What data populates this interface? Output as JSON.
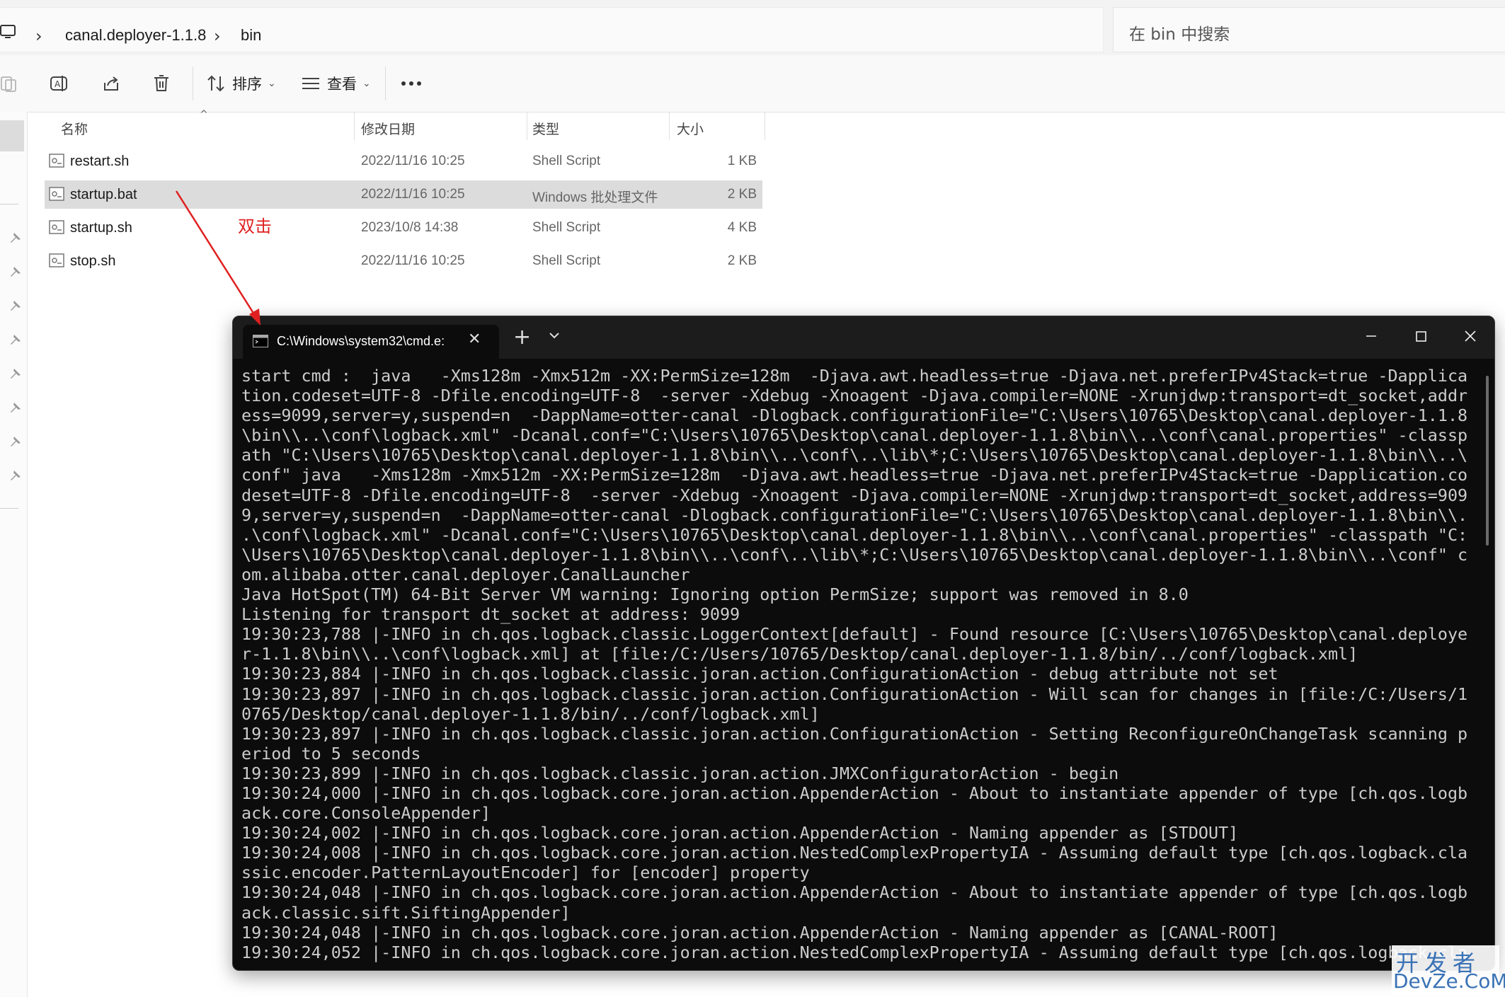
{
  "address_bar": {
    "crumbs": [
      "canal.deployer-1.1.8",
      "bin"
    ],
    "search_placeholder": "在 bin 中搜索"
  },
  "toolbar": {
    "sort_label": "排序",
    "view_label": "查看"
  },
  "columns": {
    "name": "名称",
    "modified": "修改日期",
    "type": "类型",
    "size": "大小"
  },
  "files": [
    {
      "name": "restart.sh",
      "modified": "2022/11/16 10:25",
      "type": "Shell Script",
      "size": "1 KB"
    },
    {
      "name": "startup.bat",
      "modified": "2022/11/16 10:25",
      "type": "Windows 批处理文件",
      "size": "2 KB"
    },
    {
      "name": "startup.sh",
      "modified": "2023/10/8 14:38",
      "type": "Shell Script",
      "size": "4 KB"
    },
    {
      "name": "stop.sh",
      "modified": "2022/11/16 10:25",
      "type": "Shell Script",
      "size": "2 KB"
    }
  ],
  "annotation": {
    "text": "双击",
    "color": "#e02020"
  },
  "terminal": {
    "tab_title": "C:\\Windows\\system32\\cmd.e:",
    "output": "start cmd :  java   -Xms128m -Xmx512m -XX:PermSize=128m  -Djava.awt.headless=true -Djava.net.preferIPv4Stack=true -Dapplica\ntion.codeset=UTF-8 -Dfile.encoding=UTF-8  -server -Xdebug -Xnoagent -Djava.compiler=NONE -Xrunjdwp:transport=dt_socket,addr\ness=9099,server=y,suspend=n  -DappName=otter-canal -Dlogback.configurationFile=\"C:\\Users\\10765\\Desktop\\canal.deployer-1.1.8\n\\bin\\\\..\\conf\\logback.xml\" -Dcanal.conf=\"C:\\Users\\10765\\Desktop\\canal.deployer-1.1.8\\bin\\\\..\\conf\\canal.properties\" -classp\nath \"C:\\Users\\10765\\Desktop\\canal.deployer-1.1.8\\bin\\\\..\\conf\\..\\lib\\*;C:\\Users\\10765\\Desktop\\canal.deployer-1.1.8\\bin\\\\..\\\nconf\" java   -Xms128m -Xmx512m -XX:PermSize=128m  -Djava.awt.headless=true -Djava.net.preferIPv4Stack=true -Dapplication.co\ndeset=UTF-8 -Dfile.encoding=UTF-8  -server -Xdebug -Xnoagent -Djava.compiler=NONE -Xrunjdwp:transport=dt_socket,address=909\n9,server=y,suspend=n  -DappName=otter-canal -Dlogback.configurationFile=\"C:\\Users\\10765\\Desktop\\canal.deployer-1.1.8\\bin\\\\.\n.\\conf\\logback.xml\" -Dcanal.conf=\"C:\\Users\\10765\\Desktop\\canal.deployer-1.1.8\\bin\\\\..\\conf\\canal.properties\" -classpath \"C:\n\\Users\\10765\\Desktop\\canal.deployer-1.1.8\\bin\\\\..\\conf\\..\\lib\\*;C:\\Users\\10765\\Desktop\\canal.deployer-1.1.8\\bin\\\\..\\conf\" c\nom.alibaba.otter.canal.deployer.CanalLauncher\nJava HotSpot(TM) 64-Bit Server VM warning: Ignoring option PermSize; support was removed in 8.0\nListening for transport dt_socket at address: 9099\n19:30:23,788 |-INFO in ch.qos.logback.classic.LoggerContext[default] - Found resource [C:\\Users\\10765\\Desktop\\canal.deploye\nr-1.1.8\\bin\\\\..\\conf\\logback.xml] at [file:/C:/Users/10765/Desktop/canal.deployer-1.1.8/bin/../conf/logback.xml]\n19:30:23,884 |-INFO in ch.qos.logback.classic.joran.action.ConfigurationAction - debug attribute not set\n19:30:23,897 |-INFO in ch.qos.logback.classic.joran.action.ConfigurationAction - Will scan for changes in [file:/C:/Users/1\n0765/Desktop/canal.deployer-1.1.8/bin/../conf/logback.xml]\n19:30:23,897 |-INFO in ch.qos.logback.classic.joran.action.ConfigurationAction - Setting ReconfigureOnChangeTask scanning p\neriod to 5 seconds\n19:30:23,899 |-INFO in ch.qos.logback.classic.joran.action.JMXConfiguratorAction - begin\n19:30:24,000 |-INFO in ch.qos.logback.core.joran.action.AppenderAction - About to instantiate appender of type [ch.qos.logb\nack.core.ConsoleAppender]\n19:30:24,002 |-INFO in ch.qos.logback.core.joran.action.AppenderAction - Naming appender as [STDOUT]\n19:30:24,008 |-INFO in ch.qos.logback.core.joran.action.NestedComplexPropertyIA - Assuming default type [ch.qos.logback.cla\nssic.encoder.PatternLayoutEncoder] for [encoder] property\n19:30:24,048 |-INFO in ch.qos.logback.core.joran.action.AppenderAction - About to instantiate appender of type [ch.qos.logb\nack.classic.sift.SiftingAppender]\n19:30:24,048 |-INFO in ch.qos.logback.core.joran.action.AppenderAction - Naming appender as [CANAL-ROOT]\n19:30:24,052 |-INFO in ch.qos.logback.core.joran.action.NestedComplexPropertyIA - Assuming default type [ch.qos.logback.cla"
  },
  "watermark": {
    "line1": "开发者",
    "line2": "DevZe.CoM"
  }
}
